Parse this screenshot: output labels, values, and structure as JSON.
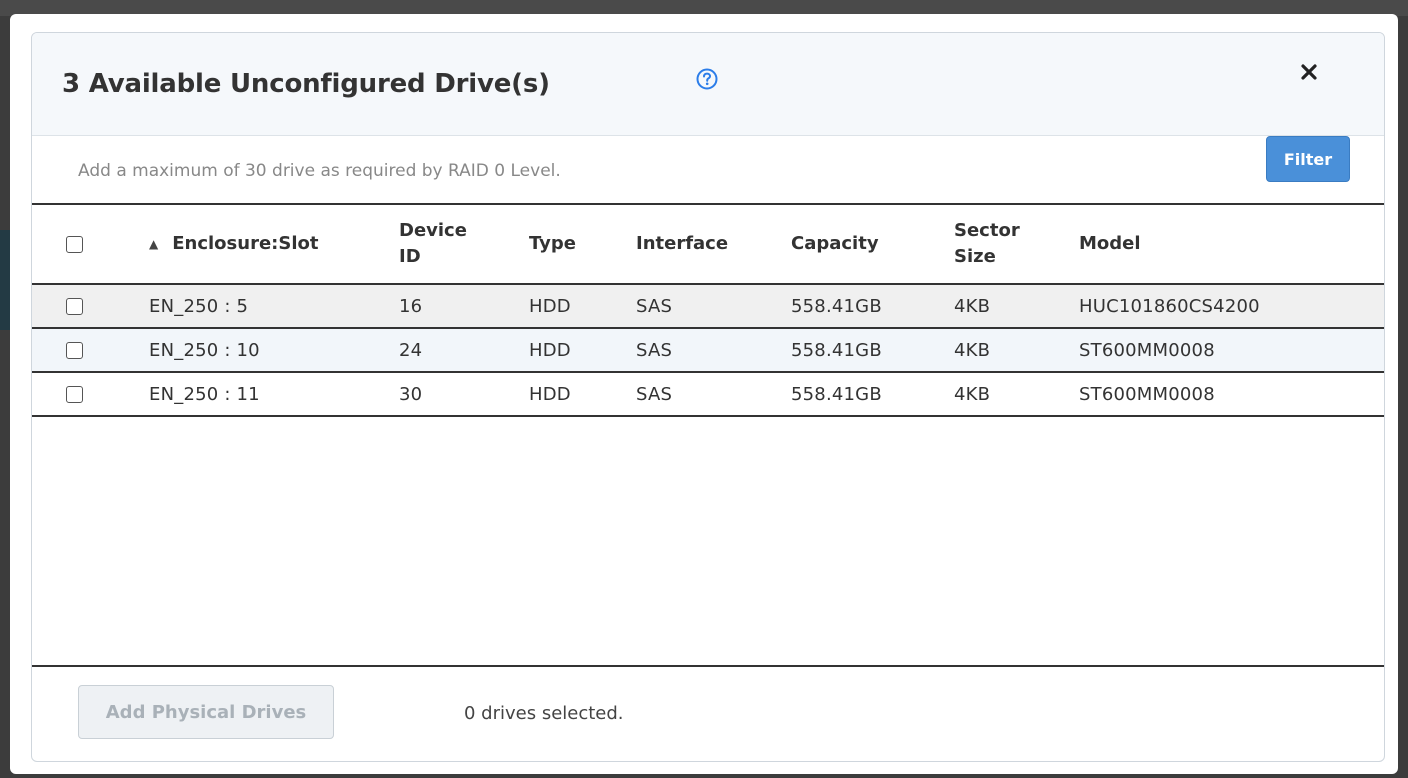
{
  "modal": {
    "title": "3 Available Unconfigured Drive(s)",
    "subtitle": "Add a maximum of 30 drive as required by RAID 0 Level.",
    "filter_label": "Filter",
    "help_icon": "question-circle-icon",
    "close_icon": "close-icon",
    "accent_color": "#4a90d9"
  },
  "table": {
    "sort_indicator": "▲",
    "columns": {
      "slot": "Enclosure:Slot",
      "device_id": "Device ID",
      "type": "Type",
      "interface": "Interface",
      "capacity": "Capacity",
      "sector_size": "Sector Size",
      "model": "Model"
    },
    "rows": [
      {
        "slot": "EN_250 : 5",
        "device_id": "16",
        "type": "HDD",
        "interface": "SAS",
        "capacity": "558.41GB",
        "sector_size": "4KB",
        "model": "HUC101860CS4200"
      },
      {
        "slot": "EN_250 : 10",
        "device_id": "24",
        "type": "HDD",
        "interface": "SAS",
        "capacity": "558.41GB",
        "sector_size": "4KB",
        "model": "ST600MM0008"
      },
      {
        "slot": "EN_250 : 11",
        "device_id": "30",
        "type": "HDD",
        "interface": "SAS",
        "capacity": "558.41GB",
        "sector_size": "4KB",
        "model": "ST600MM0008"
      }
    ]
  },
  "footer": {
    "add_button_label": "Add Physical Drives",
    "selected_text": "0 drives selected."
  }
}
